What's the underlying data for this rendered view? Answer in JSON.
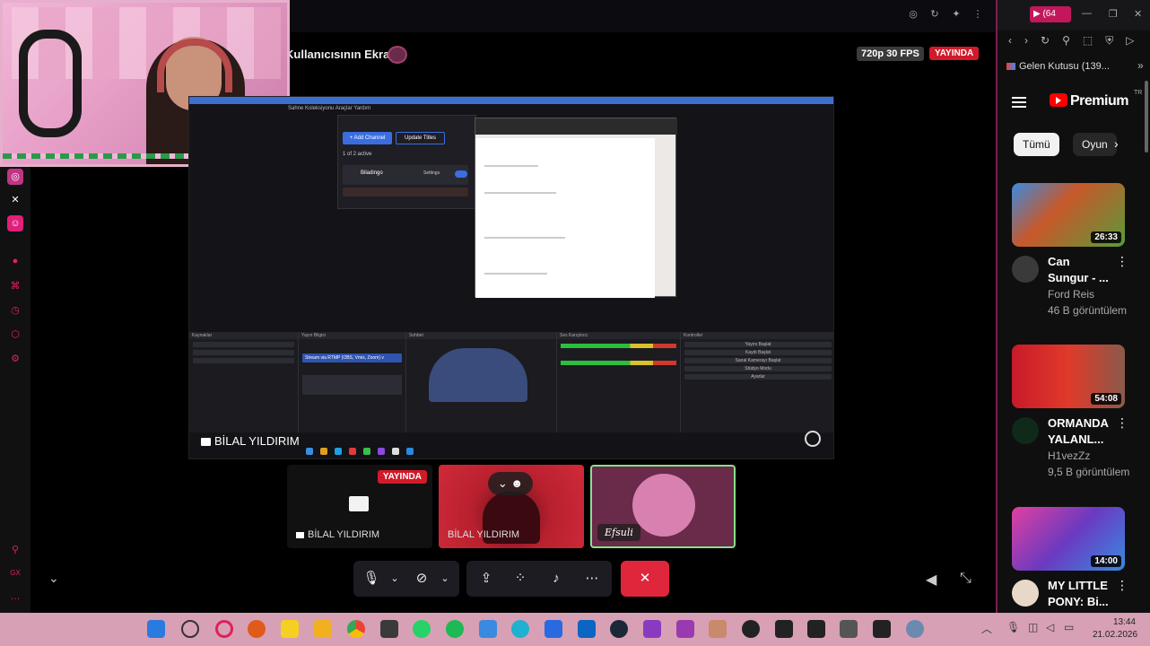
{
  "meeting": {
    "share_title": "Kullanıcısının Ekranı",
    "quality_badge": "720p 30 FPS",
    "live_badge": "YAYINDA",
    "presenter_label": "BİLAL YILDIRIM"
  },
  "shared_screen": {
    "menu_text": "Sahne Koleksiyonu   Araçlar   Yardım",
    "dialog_btn_add": "+ Add Channel",
    "dialog_btn_update": "Update Titles",
    "dialog_status": "1 of 2 active",
    "dialog_channel": "Biladingo",
    "dialog_settings": "Settings",
    "dock_sources": "Kaynaklar",
    "dock_stream_info": "Yayın Bilgisi",
    "dock_chat": "Sohbet",
    "dock_audio": "Ses Karıştırıcı",
    "dock_controls": "Kontroller",
    "stream_title_value": "Stream via RTMP (OBS, Vmix, Zoom) v",
    "controls": [
      "Yayını Başlat",
      "Kaydı Başlat",
      "Sanal Kamerayı Başlat",
      "Stüdyo Modu",
      "Ayarlar"
    ]
  },
  "participants": [
    {
      "name": "BİLAL YILDIRIM",
      "badge": "YAYINDA"
    },
    {
      "name": "BİLAL YILDIRIM"
    },
    {
      "name": "Efsuli"
    }
  ],
  "controls": {
    "mic": "mic-icon",
    "camera": "camera-off-icon",
    "share": "screen-share-icon",
    "activities": "activities-icon",
    "soundboard": "soundboard-icon",
    "more": "more-icon",
    "end": "end-call-icon"
  },
  "right_panel": {
    "yt_tab_count": "(64",
    "gmail_label": "Gelen Kutusu (139...",
    "brand": "Premium",
    "region": "TR",
    "chips": [
      "Tümü",
      "Oyun"
    ],
    "videos": [
      {
        "duration": "26:33",
        "title": "Can Sungur - ...",
        "channel": "Ford Reis",
        "views": "46 B görüntülem",
        "thumb_color": "#c8582a"
      },
      {
        "duration": "54:08",
        "title": "ORMANDA YALANL...",
        "channel": "H1vezZz",
        "views": "9,5 B görüntülem",
        "thumb_color": "#c81a2a"
      },
      {
        "duration": "14:00",
        "title": "MY LITTLE PONY: Bi...",
        "channel": "",
        "views": "",
        "thumb_color": "#6a3ac0"
      }
    ]
  },
  "taskbar": {
    "time": "13:44",
    "date": "21.02.2026"
  },
  "colors": {
    "live_red": "#d11a2a",
    "end_call_red": "#e0263a",
    "taskbar_pink": "#d8a0b4",
    "youtube_red": "#ff0000"
  }
}
